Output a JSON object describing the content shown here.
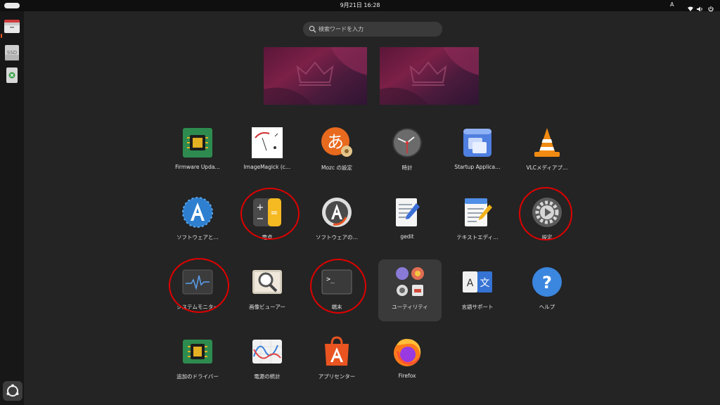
{
  "topbar": {
    "datetime": "9月21日 16:28",
    "input_method": "A"
  },
  "dock": {
    "items": [
      {
        "name": "ファイル",
        "icon": "folder-icon"
      },
      {
        "name": "SSD",
        "icon": "drive-icon",
        "label": "SSD"
      },
      {
        "name": "ゴミ箱",
        "icon": "trash-icon"
      }
    ]
  },
  "search": {
    "placeholder": "検索ワードを入力"
  },
  "workspaces": [
    {
      "index": 1
    },
    {
      "index": 2
    }
  ],
  "apps": [
    {
      "label": "Firmware Upda…",
      "icon": "chip-green-icon"
    },
    {
      "label": "ImageMagick (c…",
      "icon": "imagemagick-icon"
    },
    {
      "label": "Mozc の設定",
      "icon": "mozc-icon"
    },
    {
      "label": "時計",
      "icon": "clock-icon"
    },
    {
      "label": "Startup Applica…",
      "icon": "startup-apps-icon"
    },
    {
      "label": "VLCメディアプ…",
      "icon": "vlc-cone-icon"
    },
    {
      "label": "ソフトウェアと…",
      "icon": "software-blue-icon"
    },
    {
      "label": "電卓",
      "icon": "calculator-icon"
    },
    {
      "label": "ソフトウェアの…",
      "icon": "software-updater-icon"
    },
    {
      "label": "gedit",
      "icon": "gedit-icon"
    },
    {
      "label": "テキストエディ…",
      "icon": "text-editor-icon"
    },
    {
      "label": "設定",
      "icon": "settings-gear-icon"
    },
    {
      "label": "システムモニター",
      "icon": "system-monitor-icon"
    },
    {
      "label": "画像ビューアー",
      "icon": "image-viewer-icon"
    },
    {
      "label": "端末",
      "icon": "terminal-icon"
    },
    {
      "label": "ユーティリティ",
      "icon": "folder-utilities-icon"
    },
    {
      "label": "言語サポート",
      "icon": "language-support-icon"
    },
    {
      "label": "ヘルプ",
      "icon": "help-icon"
    },
    {
      "label": "追加のドライバー",
      "icon": "chip-green-icon"
    },
    {
      "label": "電源の統計",
      "icon": "power-stats-icon"
    },
    {
      "label": "アプリセンター",
      "icon": "app-center-icon"
    },
    {
      "label": "Firefox",
      "icon": "firefox-icon"
    }
  ],
  "colors": {
    "accent": "#e95420",
    "annotation_circle": "#e00000",
    "background": "#242424"
  }
}
